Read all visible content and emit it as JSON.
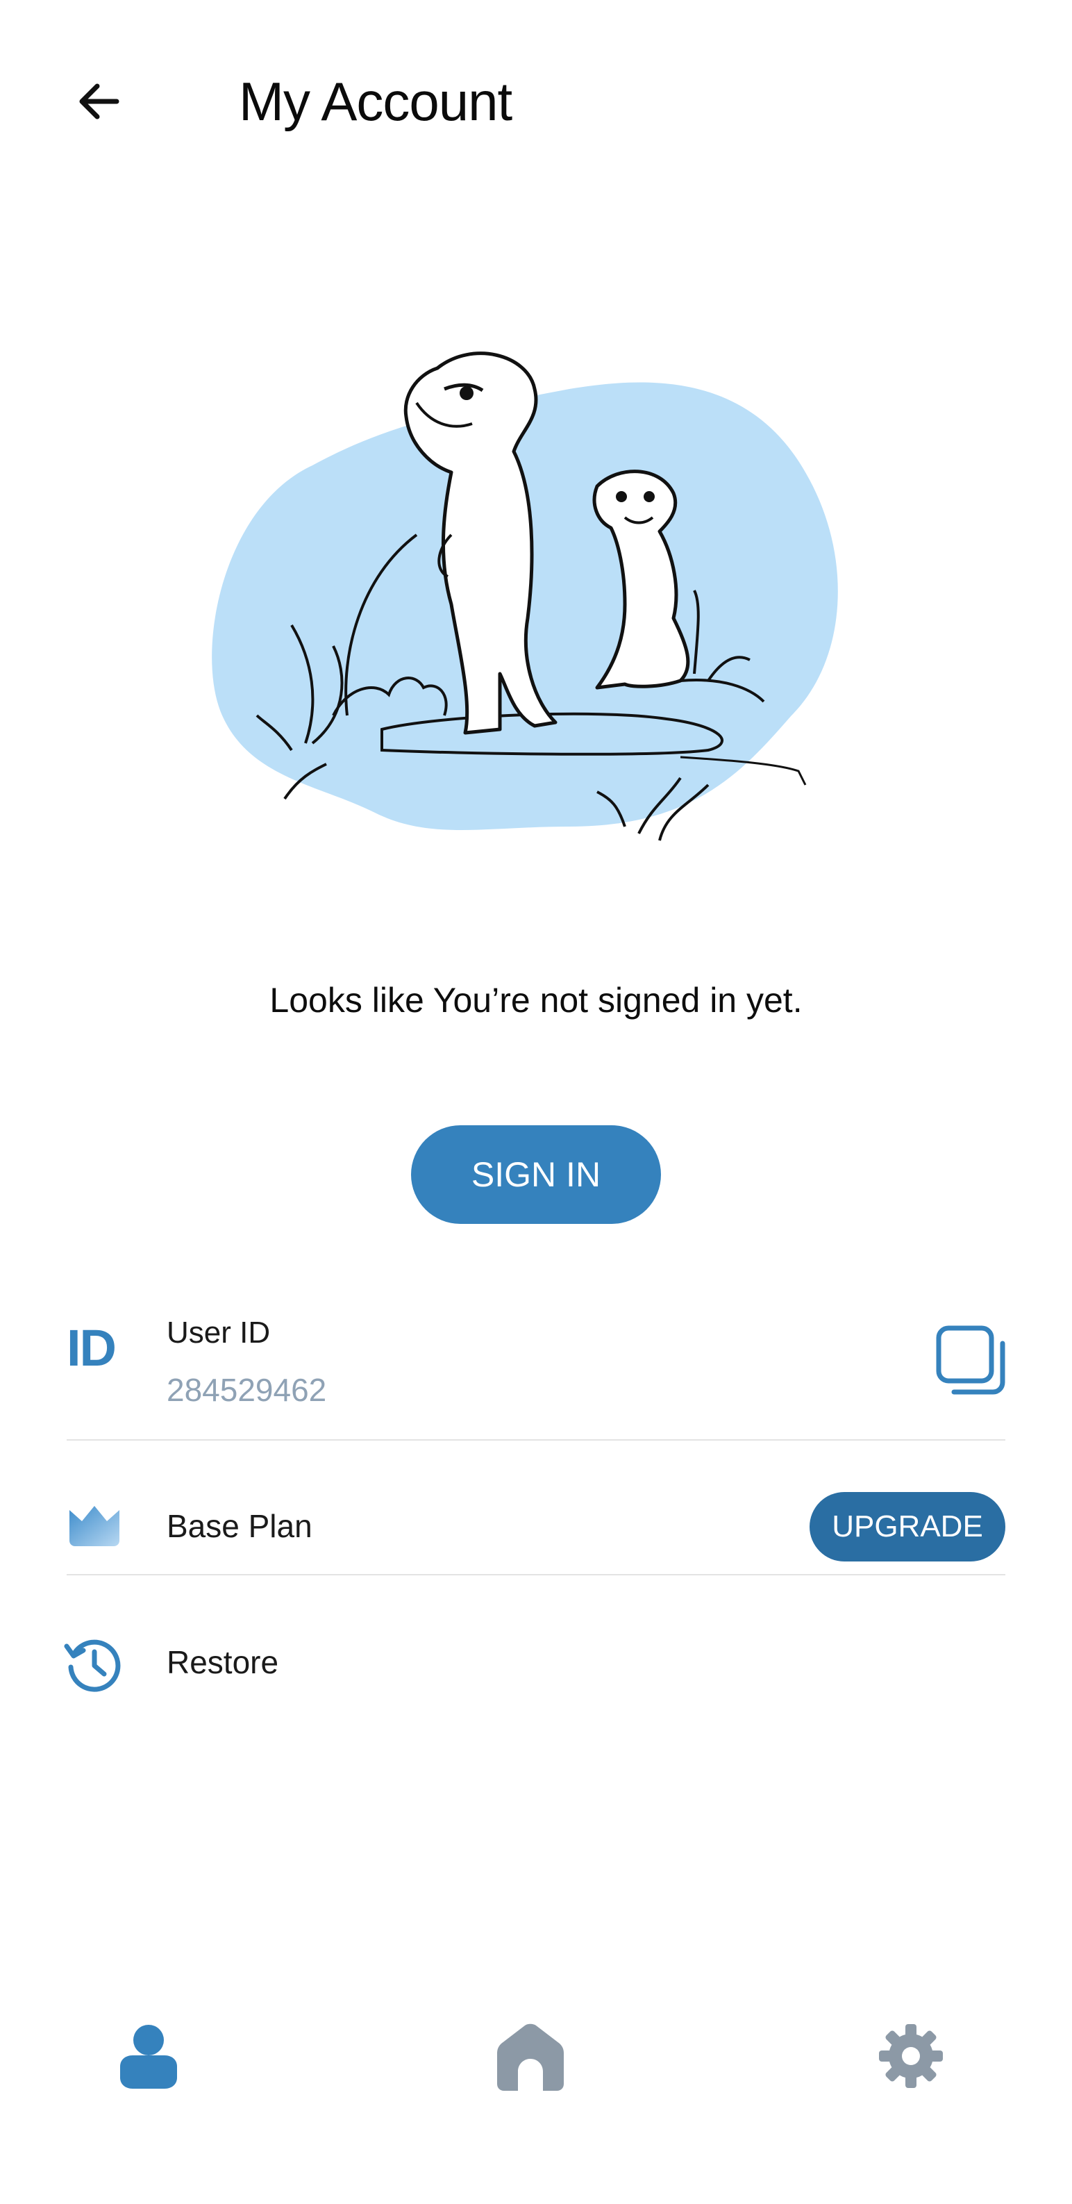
{
  "header": {
    "title": "My Account",
    "back_icon": "arrow-left-icon"
  },
  "illustration": {
    "description_icon": "meerkats-illustration",
    "blob_color": "#bbdff8"
  },
  "status": {
    "message": "Looks like You’re not signed in yet."
  },
  "signin": {
    "label": "SIGN IN"
  },
  "user_id": {
    "icon_text": "ID",
    "label": "User ID",
    "value": "284529462",
    "copy_icon": "copy-icon"
  },
  "plan": {
    "icon": "crown-icon",
    "label": "Base Plan",
    "upgrade_label": "UPGRADE"
  },
  "restore": {
    "icon": "history-icon",
    "label": "Restore"
  },
  "bottom_nav": {
    "items": [
      {
        "name": "account",
        "icon": "user-icon",
        "active": true
      },
      {
        "name": "home",
        "icon": "home-icon",
        "active": false
      },
      {
        "name": "settings",
        "icon": "gear-icon",
        "active": false
      }
    ]
  },
  "colors": {
    "accent": "#3582bd",
    "upgrade": "#2a6ea3",
    "muted": "#8fa2b5",
    "inactive_nav": "#8c99a6"
  }
}
